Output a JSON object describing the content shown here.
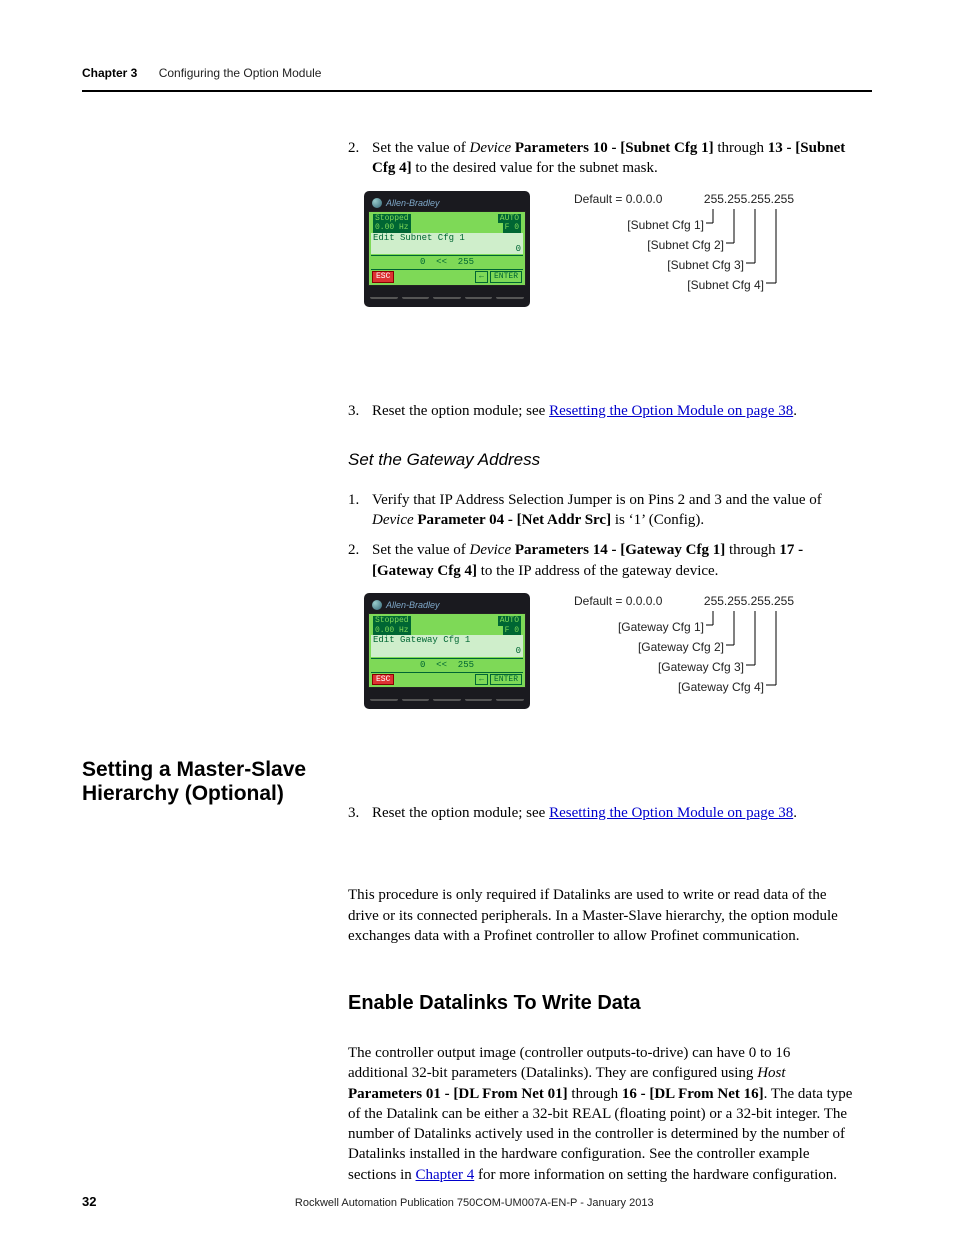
{
  "header": {
    "chapter": "Chapter 3",
    "title": "Configuring the Option Module"
  },
  "steps_a": {
    "n2": "2.",
    "t2_a": "Set the value of ",
    "t2_b": "Device",
    "t2_c": " Parameters 10 - [Subnet Cfg 1]",
    "t2_d": " through ",
    "t2_e": "13 - [Subnet Cfg 4]",
    "t2_f": " to the desired value for the subnet mask.",
    "n3": "3.",
    "t3_a": "Reset the option module; see ",
    "t3_link": "Resetting the Option Module on page 38",
    "t3_b": "."
  },
  "him1": {
    "brand": "Allen-Bradley",
    "status": "Stopped",
    "auto": "AUTO",
    "hz": "0.00 Hz",
    "f0": "F 0",
    "edit": "Edit Subnet Cfg 1",
    "val": "0",
    "range": "0  <<  255",
    "esc": "ESC",
    "arrow": "←",
    "enter": "ENTER"
  },
  "tree1": {
    "def": "Default = 0.0.0.0",
    "max": "255.255.255.255",
    "l1": "[Subnet Cfg 1]",
    "l2": "[Subnet Cfg 2]",
    "l3": "[Subnet Cfg 3]",
    "l4": "[Subnet Cfg 4]"
  },
  "sub_it": "Set the Gateway Address",
  "steps_b": {
    "n1": "1.",
    "t1_a": "Verify that IP Address Selection Jumper is on Pins 2 and 3 and the value of ",
    "t1_b": "Device",
    "t1_c": " Parameter 04 - [Net Addr Src]",
    "t1_d": " is ‘1’ (Config).",
    "n2": "2.",
    "t2_a": "Set the value of ",
    "t2_b": "Device",
    "t2_c": " Parameters 14 - [Gateway Cfg 1]",
    "t2_d": " through ",
    "t2_e": "17 - [Gateway Cfg 4]",
    "t2_f": " to the IP address of the gateway device.",
    "n3": "3.",
    "t3_a": "Reset the option module; see ",
    "t3_link": "Resetting the Option Module on page 38",
    "t3_b": "."
  },
  "him2": {
    "brand": "Allen-Bradley",
    "status": "Stopped",
    "auto": "AUTO",
    "hz": "0.00 Hz",
    "f0": "F 0",
    "edit": "Edit Gateway Cfg 1",
    "val": "0",
    "range": "0  <<  255",
    "esc": "ESC",
    "arrow": "←",
    "enter": "ENTER"
  },
  "tree2": {
    "def": "Default = 0.0.0.0",
    "max": "255.255.255.255",
    "l1": "[Gateway Cfg 1]",
    "l2": "[Gateway Cfg 2]",
    "l3": "[Gateway Cfg 3]",
    "l4": "[Gateway Cfg 4]"
  },
  "side1": "Setting a Master-Slave Hierarchy (Optional)",
  "para1": "This procedure is only required if Datalinks are used to write or read data of the drive or its connected peripherals. In a Master-Slave hierarchy, the option module exchanges data with a Profinet controller to allow Profinet communication.",
  "h2a": "Enable Datalinks To Write Data",
  "para2_a": "The controller output image (controller outputs-to-drive) can have 0 to 16 additional 32-bit parameters (Datalinks). They are configured using ",
  "para2_b": "Host",
  "para2_c": " Parameters 01 - [DL From Net 01]",
  "para2_d": " through ",
  "para2_e": "16 - [DL From Net 16]",
  "para2_f": ". The data type of the Datalink can be either a 32-bit REAL (floating point) or a 32-bit integer. The number of Datalinks actively used in the controller is determined by the number of Datalinks installed in the hardware configuration. See the controller example sections in ",
  "para2_link": "Chapter 4",
  "para2_g": " for more information on setting the hardware configuration.",
  "footer": {
    "page": "32",
    "pub": "Rockwell Automation Publication 750COM-UM007A-EN-P - January 2013"
  }
}
